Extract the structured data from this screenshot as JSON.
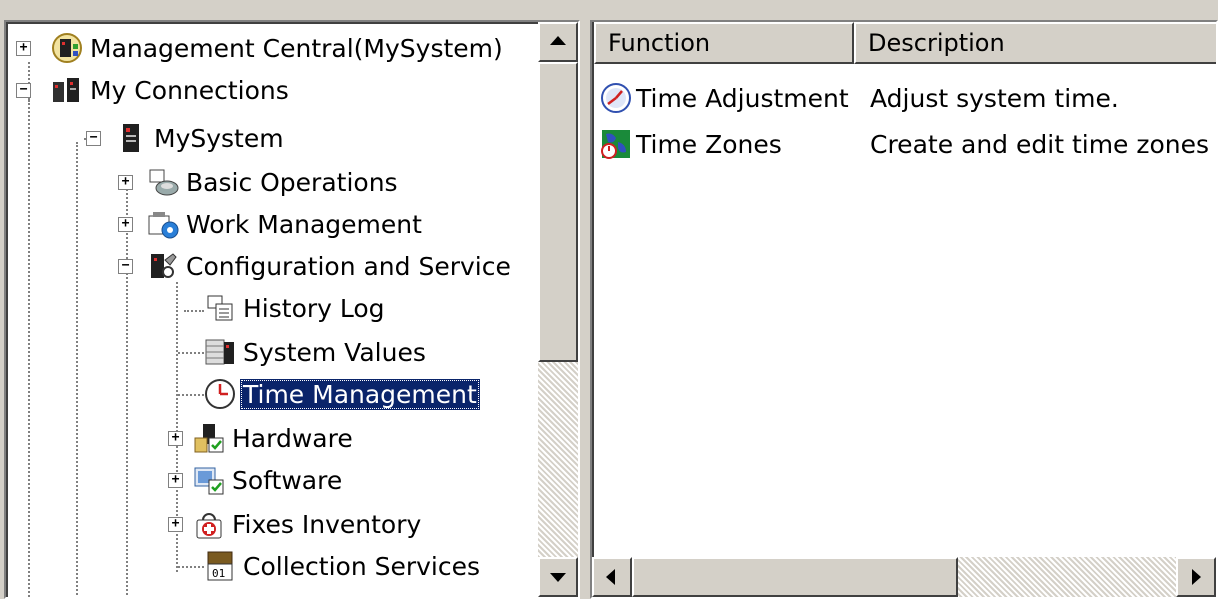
{
  "tree": {
    "items": [
      {
        "label": "Management Central(MySystem)",
        "icon": "management-central-icon",
        "expander": "+"
      },
      {
        "label": "My Connections",
        "icon": "connections-icon",
        "expander": "−"
      },
      {
        "label": "MySystem",
        "icon": "system-tower-icon",
        "expander": "−"
      },
      {
        "label": "Basic Operations",
        "icon": "basic-operations-icon",
        "expander": "+"
      },
      {
        "label": "Work Management",
        "icon": "work-management-icon",
        "expander": "+"
      },
      {
        "label": "Configuration and Service",
        "icon": "configuration-service-icon",
        "expander": "−"
      },
      {
        "label": "History Log",
        "icon": "history-log-icon",
        "expander": ""
      },
      {
        "label": "System Values",
        "icon": "system-values-icon",
        "expander": ""
      },
      {
        "label": "Time Management",
        "icon": "clock-icon",
        "expander": "",
        "selected": true
      },
      {
        "label": "Hardware",
        "icon": "hardware-icon",
        "expander": "+"
      },
      {
        "label": "Software",
        "icon": "software-icon",
        "expander": "+"
      },
      {
        "label": "Fixes Inventory",
        "icon": "fixes-inventory-icon",
        "expander": "+"
      },
      {
        "label": "Collection Services",
        "icon": "collection-services-icon",
        "expander": ""
      }
    ]
  },
  "list": {
    "columns": [
      "Function",
      "Description"
    ],
    "rows": [
      {
        "function": "Time Adjustment",
        "description": "Adjust system time.",
        "icon": "time-adjustment-icon"
      },
      {
        "function": "Time Zones",
        "description": "Create and edit time zones",
        "icon": "time-zones-icon"
      }
    ]
  },
  "colors": {
    "selection": "#0a246a",
    "face": "#d4d0c8"
  }
}
